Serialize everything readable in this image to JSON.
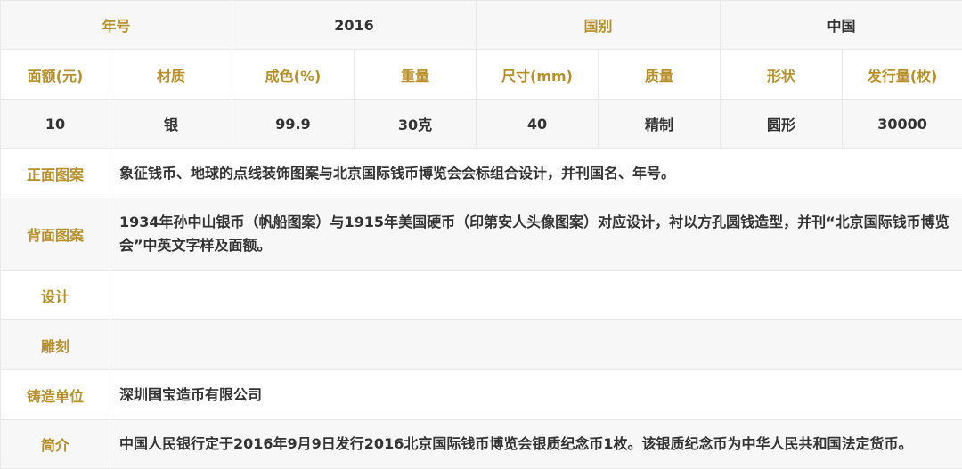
{
  "summary": {
    "year_label": "年号",
    "year_value": "2016",
    "country_label": "国别",
    "country_value": "中国"
  },
  "spec_headers": [
    "面额(元)",
    "材质",
    "成色(%)",
    "重量",
    "尺寸(mm)",
    "质量",
    "形状",
    "发行量(枚)"
  ],
  "spec_values": [
    "10",
    "银",
    "99.9",
    "30克",
    "40",
    "精制",
    "圆形",
    "30000"
  ],
  "details": [
    {
      "label": "正面图案",
      "value": "象征钱币、地球的点线装饰图案与北京国际钱币博览会会标组合设计，并刊国名、年号。"
    },
    {
      "label": "背面图案",
      "value": "1934年孙中山银币（帆船图案）与1915年美国硬币（印第安人头像图案）对应设计，衬以方孔圆钱造型，并刊“北京国际钱币博览会”中英文字样及面额。"
    },
    {
      "label": "设计",
      "value": ""
    },
    {
      "label": "雕刻",
      "value": ""
    },
    {
      "label": "铸造单位",
      "value": "深圳国宝造币有限公司"
    },
    {
      "label": "简介",
      "value": "中国人民银行定于2016年9月9日发行2016北京国际钱币博览会银质纪念币1枚。该银质纪念币为中华人民共和国法定货币。"
    }
  ],
  "colors": {
    "label_gold": "#b8902a",
    "text": "#333333",
    "row_shade": "#f7f7f7",
    "border": "#e9e9e9"
  }
}
